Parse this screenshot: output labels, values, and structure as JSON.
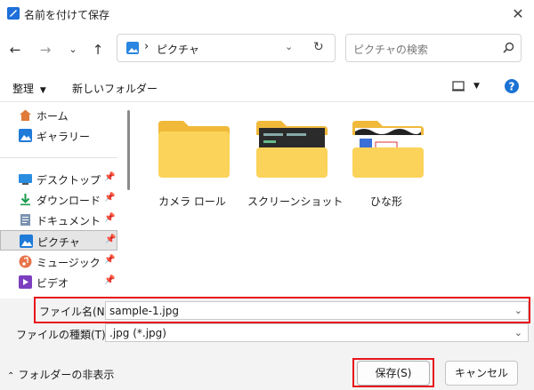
{
  "window": {
    "title": "名前を付けて保存"
  },
  "nav": {
    "back_icon": "arrow-left-icon",
    "forward_icon": "arrow-right-icon",
    "recent_icon": "chevron-down-icon",
    "up_icon": "arrow-up-icon",
    "breadcrumb_sep": "›",
    "current_location": "ピクチャ",
    "refresh_icon": "refresh-icon"
  },
  "search": {
    "placeholder": "ピクチャの検索",
    "icon": "search-icon"
  },
  "toolbar": {
    "organize": "整理",
    "new_folder": "新しいフォルダー"
  },
  "sidebar": {
    "items": [
      {
        "label": "ホーム"
      },
      {
        "label": "ギャラリー"
      },
      {
        "label": "デスクトップ"
      },
      {
        "label": "ダウンロード"
      },
      {
        "label": "ドキュメント"
      },
      {
        "label": "ピクチャ"
      },
      {
        "label": "ミュージック"
      },
      {
        "label": "ビデオ"
      }
    ]
  },
  "folders": [
    {
      "label": "カメラ ロール"
    },
    {
      "label": "スクリーンショット"
    },
    {
      "label": "ひな形"
    }
  ],
  "form": {
    "filename_label": "ファイル名(N):",
    "filename_value": "sample-1.jpg",
    "filetype_label": "ファイルの種類(T):",
    "filetype_value": ".jpg (*.jpg)"
  },
  "footer": {
    "hide_folders": "フォルダーの非表示",
    "save": "保存(S)",
    "cancel": "キャンセル"
  },
  "colors": {
    "accent": "#0067c0",
    "highlight": "#e8141b",
    "folder": "#f7c948"
  }
}
